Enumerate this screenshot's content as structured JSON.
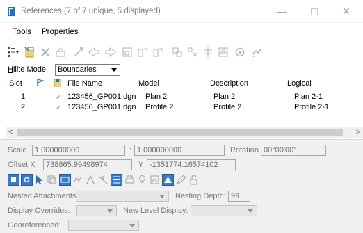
{
  "window": {
    "title": "References (7 of 7 unique, 5 displayed)",
    "min_glyph": "—",
    "close_glyph": "✕"
  },
  "menu": {
    "tools": "Tools",
    "tools_mnemonic": "T",
    "tools_rest": "ools",
    "properties": "Properties",
    "properties_mnemonic": "P",
    "properties_rest": "roperties"
  },
  "hilite": {
    "label": "Hilite Mode:",
    "label_mnemonic": "H",
    "label_rest": "ilite Mode:",
    "value": "Boundaries"
  },
  "table": {
    "columns": {
      "slot": "Slot",
      "file_name": "File Name",
      "model": "Model",
      "description": "Description",
      "logical": "Logical"
    },
    "rows": [
      {
        "slot": "1",
        "check": "✓",
        "file_name": "123456_GP001.dgn",
        "model": "Plan 2",
        "description": "Plan 2",
        "logical": "Plan 2-1"
      },
      {
        "slot": "2",
        "check": "✓",
        "file_name": "123456_GP001.dgn",
        "model": "Profile 2",
        "description": "Profile 2",
        "logical": "Profile 2-1"
      }
    ]
  },
  "scrollbar": {
    "left_arrow": "<",
    "right_arrow": ">"
  },
  "properties_panel": {
    "scale_label": "Scale",
    "scale_value_1": "1.000000000",
    "scale_sep": ":",
    "scale_value_2": "1.000000000",
    "rotation_label": "Rotation",
    "rotation_value": "00°00'00\"",
    "offset_x_label": "Offset X",
    "offset_x_value": "738865.99498974",
    "offset_y_label": "Y",
    "offset_y_value": "-1351774.16574102",
    "nested_attachments_label": "Nested Attachments:",
    "nesting_depth_label": "Nesting Depth:",
    "nesting_depth_value": "99",
    "display_overrides_label": "Display Overrides:",
    "new_level_display_label": "New Level Display:",
    "georeferenced_label": "Georeferenced:"
  },
  "colors": {
    "accent_blue": "#2a6fb6",
    "panel_bg": "#f0f0f0",
    "disabled_text": "#7a7a7a"
  }
}
